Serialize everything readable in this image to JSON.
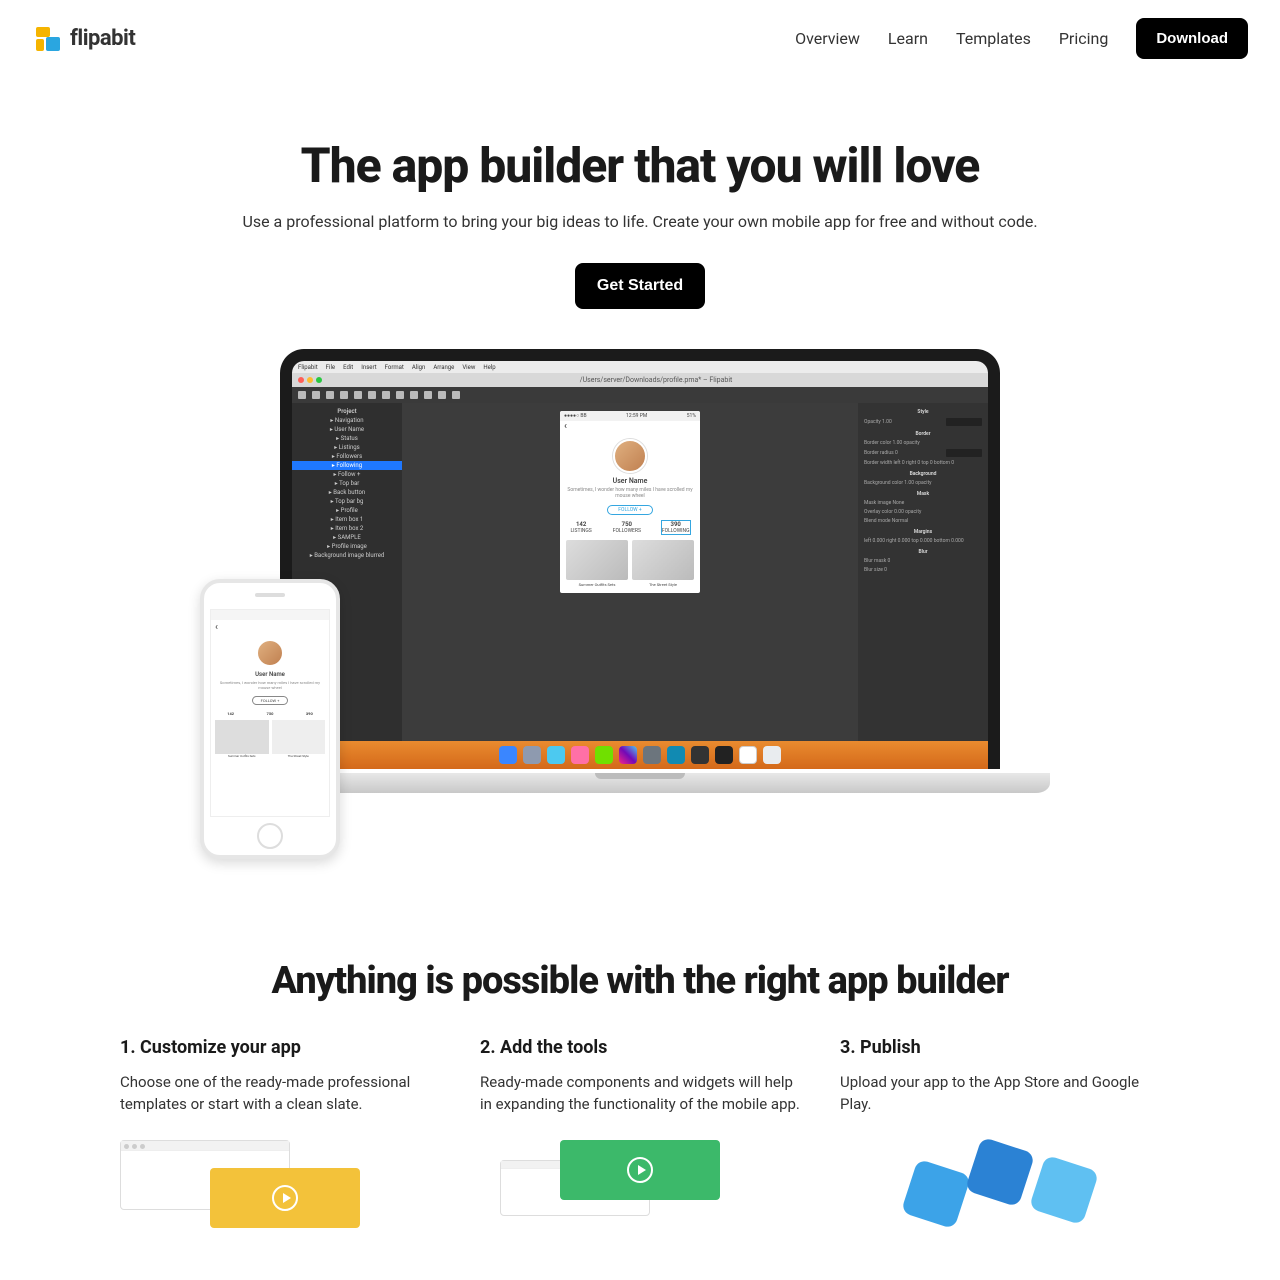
{
  "brand": {
    "name": "flipabit"
  },
  "nav": {
    "overview": "Overview",
    "learn": "Learn",
    "templates": "Templates",
    "pricing": "Pricing",
    "download": "Download"
  },
  "hero": {
    "title": "The app builder that you will love",
    "subtitle": "Use a professional platform to bring your big ideas to life. Create your own mobile app for free and without code.",
    "cta": "Get Started"
  },
  "editor": {
    "window_title": "/Users/server/Downloads/profile.pma* – Flipabit",
    "menu": [
      "Flipabit",
      "File",
      "Edit",
      "Insert",
      "Format",
      "Align",
      "Arrange",
      "View",
      "Help"
    ],
    "tree_header": "Project",
    "tree": [
      {
        "label": "Navigation",
        "sel": false
      },
      {
        "label": "  User Name",
        "sel": false
      },
      {
        "label": "  Status",
        "sel": false
      },
      {
        "label": "  Listings",
        "sel": false
      },
      {
        "label": "  Followers",
        "sel": false
      },
      {
        "label": "  Following",
        "sel": true
      },
      {
        "label": "  Follow +",
        "sel": false
      },
      {
        "label": "Top bar",
        "sel": false
      },
      {
        "label": "  Back button",
        "sel": false
      },
      {
        "label": "  Top bar bg",
        "sel": false
      },
      {
        "label": "Profile",
        "sel": false
      },
      {
        "label": "  Item box 1",
        "sel": false
      },
      {
        "label": "  Item box 2",
        "sel": false
      },
      {
        "label": "  SAMPLE",
        "sel": false
      },
      {
        "label": "  Profile image",
        "sel": false
      },
      {
        "label": "  Background image blurred",
        "sel": false
      }
    ],
    "preview": {
      "time": "12:59 PM",
      "battery": "51%",
      "user": "User Name",
      "bio": "Sometimes, I wonder how many miles I have scrolled my mouse wheel",
      "follow": "FOLLOW  +",
      "stats": [
        {
          "v": "142",
          "l": "LISTINGS"
        },
        {
          "v": "750",
          "l": "FOLLOWERS"
        },
        {
          "v": "390",
          "l": "FOLLOWING"
        }
      ],
      "cards": [
        "Summer Outfits Sets",
        "The Street Style"
      ]
    },
    "inspector": {
      "groups": [
        "Style",
        "Border",
        "Background",
        "Mask",
        "Margins",
        "Blur"
      ],
      "rows": [
        "Opacity 1.00",
        "Border color 1.00 opacity",
        "Border radius 0",
        "Border width left 0 right 0 top 0 bottom 0",
        "Background color 1.00 opacity",
        "Mask image None",
        "Overlay color 0.00 opacity",
        "Blend mode Normal",
        "left 0.000 right 0.000 top 0.000 bottom 0.000",
        "Blur mask 0",
        "Blur size 0"
      ]
    }
  },
  "section2": {
    "title": "Anything is possible with the right app builder",
    "cols": [
      {
        "h": "1. Customize your app",
        "p": "Choose one of the ready-made professional templates or start with a clean slate."
      },
      {
        "h": "2. Add the tools",
        "p": "Ready-made components and widgets will help in expanding the functionality of the mobile app."
      },
      {
        "h": "3. Publish",
        "p": "Upload your app to the App Store and Google Play."
      }
    ]
  }
}
